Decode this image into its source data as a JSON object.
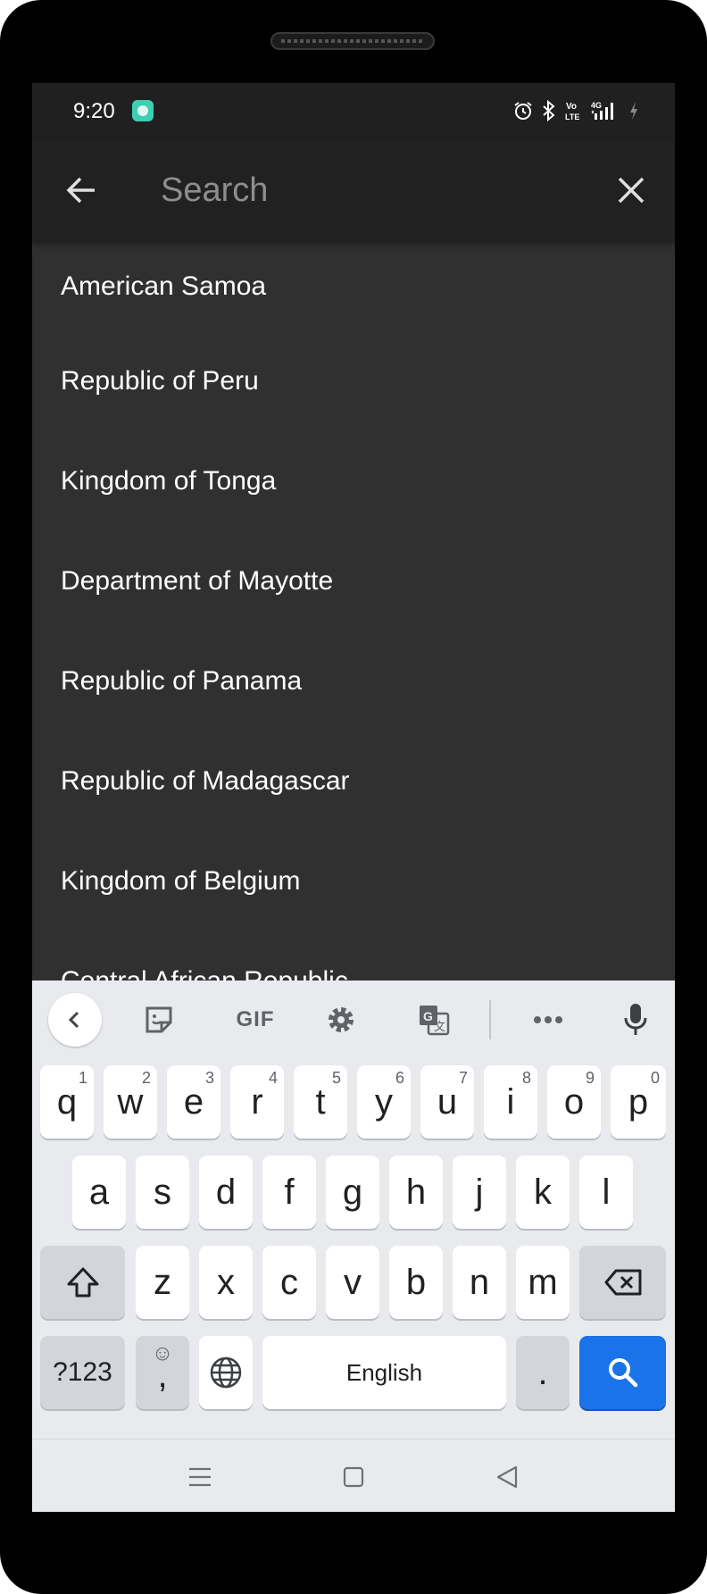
{
  "status_bar": {
    "time": "9:20",
    "icons": [
      "app-notification-icon",
      "alarm-icon",
      "bluetooth-icon",
      "volte-icon",
      "4g-signal-icon",
      "charging-icon"
    ],
    "volte_label": "Vo\nLTE",
    "network_label": "4G"
  },
  "search_bar": {
    "placeholder": "Search",
    "value": "",
    "back_icon": "arrow-back-icon",
    "clear_icon": "close-icon"
  },
  "countries": [
    {
      "name": "American Samoa"
    },
    {
      "name": "Republic of Peru"
    },
    {
      "name": "Kingdom of Tonga"
    },
    {
      "name": "Department of Mayotte"
    },
    {
      "name": "Republic of Panama"
    },
    {
      "name": "Republic of Madagascar"
    },
    {
      "name": "Kingdom of Belgium"
    },
    {
      "name": "Central African Republic"
    }
  ],
  "keyboard": {
    "toolbar": {
      "gif_label": "GIF",
      "icons": [
        "chevron-left-icon",
        "sticker-icon",
        "gif-icon",
        "settings-gear-icon",
        "translate-icon",
        "more-dots-icon",
        "microphone-icon"
      ]
    },
    "row1": [
      {
        "key": "q",
        "hint": "1"
      },
      {
        "key": "w",
        "hint": "2"
      },
      {
        "key": "e",
        "hint": "3"
      },
      {
        "key": "r",
        "hint": "4"
      },
      {
        "key": "t",
        "hint": "5"
      },
      {
        "key": "y",
        "hint": "6"
      },
      {
        "key": "u",
        "hint": "7"
      },
      {
        "key": "i",
        "hint": "8"
      },
      {
        "key": "o",
        "hint": "9"
      },
      {
        "key": "p",
        "hint": "0"
      }
    ],
    "row2": [
      "a",
      "s",
      "d",
      "f",
      "g",
      "h",
      "j",
      "k",
      "l"
    ],
    "row3": [
      "z",
      "x",
      "c",
      "v",
      "b",
      "n",
      "m"
    ],
    "symbols_label": "?123",
    "comma_label": ",",
    "emoji_glyph": "☺",
    "space_label": "English",
    "period_label": ".",
    "accent_color": "#1a73e8"
  },
  "nav_bar": {
    "icons": [
      "recents-menu-icon",
      "home-square-icon",
      "back-triangle-icon"
    ]
  }
}
